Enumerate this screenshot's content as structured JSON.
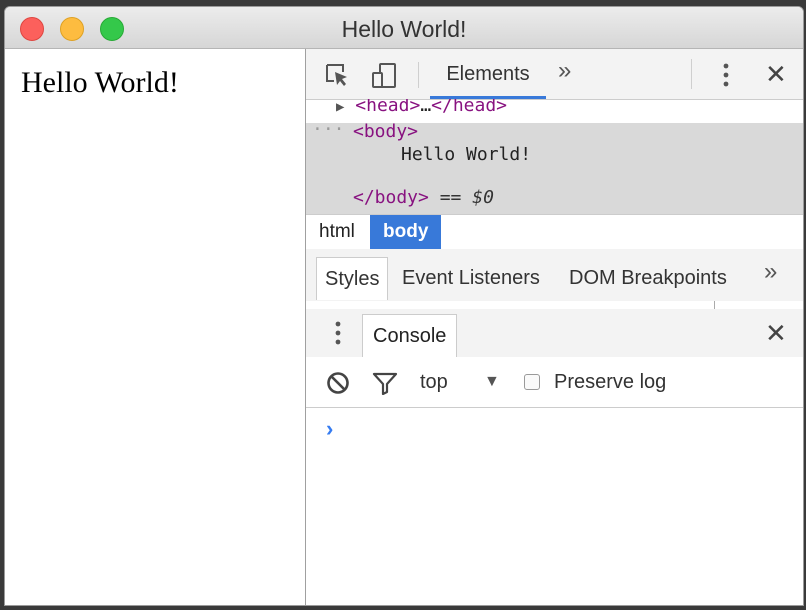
{
  "window": {
    "title": "Hello World!"
  },
  "page": {
    "content_text": "Hello World!"
  },
  "devtools": {
    "toolbar": {
      "tab_label": "Elements",
      "more_tabs": "»",
      "close_symbol": "✕",
      "accent_color": "#3879d9",
      "icons": [
        "inspect-element-icon",
        "device-toolbar-icon",
        "more-options-icon",
        "close-icon"
      ]
    },
    "dom": {
      "head_arrow": "▶",
      "head_open": "<head>",
      "head_ellipsis": "…",
      "head_close": "</head>",
      "selected_dots": "···",
      "body_open": "<body>",
      "body_text": "Hello World!",
      "body_close": "</body>",
      "eq_marker": "==",
      "dollar_ref": "$0"
    },
    "breadcrumbs": [
      {
        "label": "html",
        "active": false
      },
      {
        "label": "body",
        "active": true
      }
    ],
    "styles_tabs": {
      "styles": "Styles",
      "event_listeners": "Event Listeners",
      "dom_breakpoints": "DOM Breakpoints",
      "more": "»"
    },
    "drawer": {
      "tab_label": "Console",
      "close_symbol": "✕"
    },
    "console_toolbar": {
      "context": "top",
      "context_arrow": "▼",
      "preserve_log_label": "Preserve log",
      "preserve_log_checked": false
    },
    "console": {
      "prompt_symbol": "›",
      "prompt_color": "#367cf1"
    }
  }
}
